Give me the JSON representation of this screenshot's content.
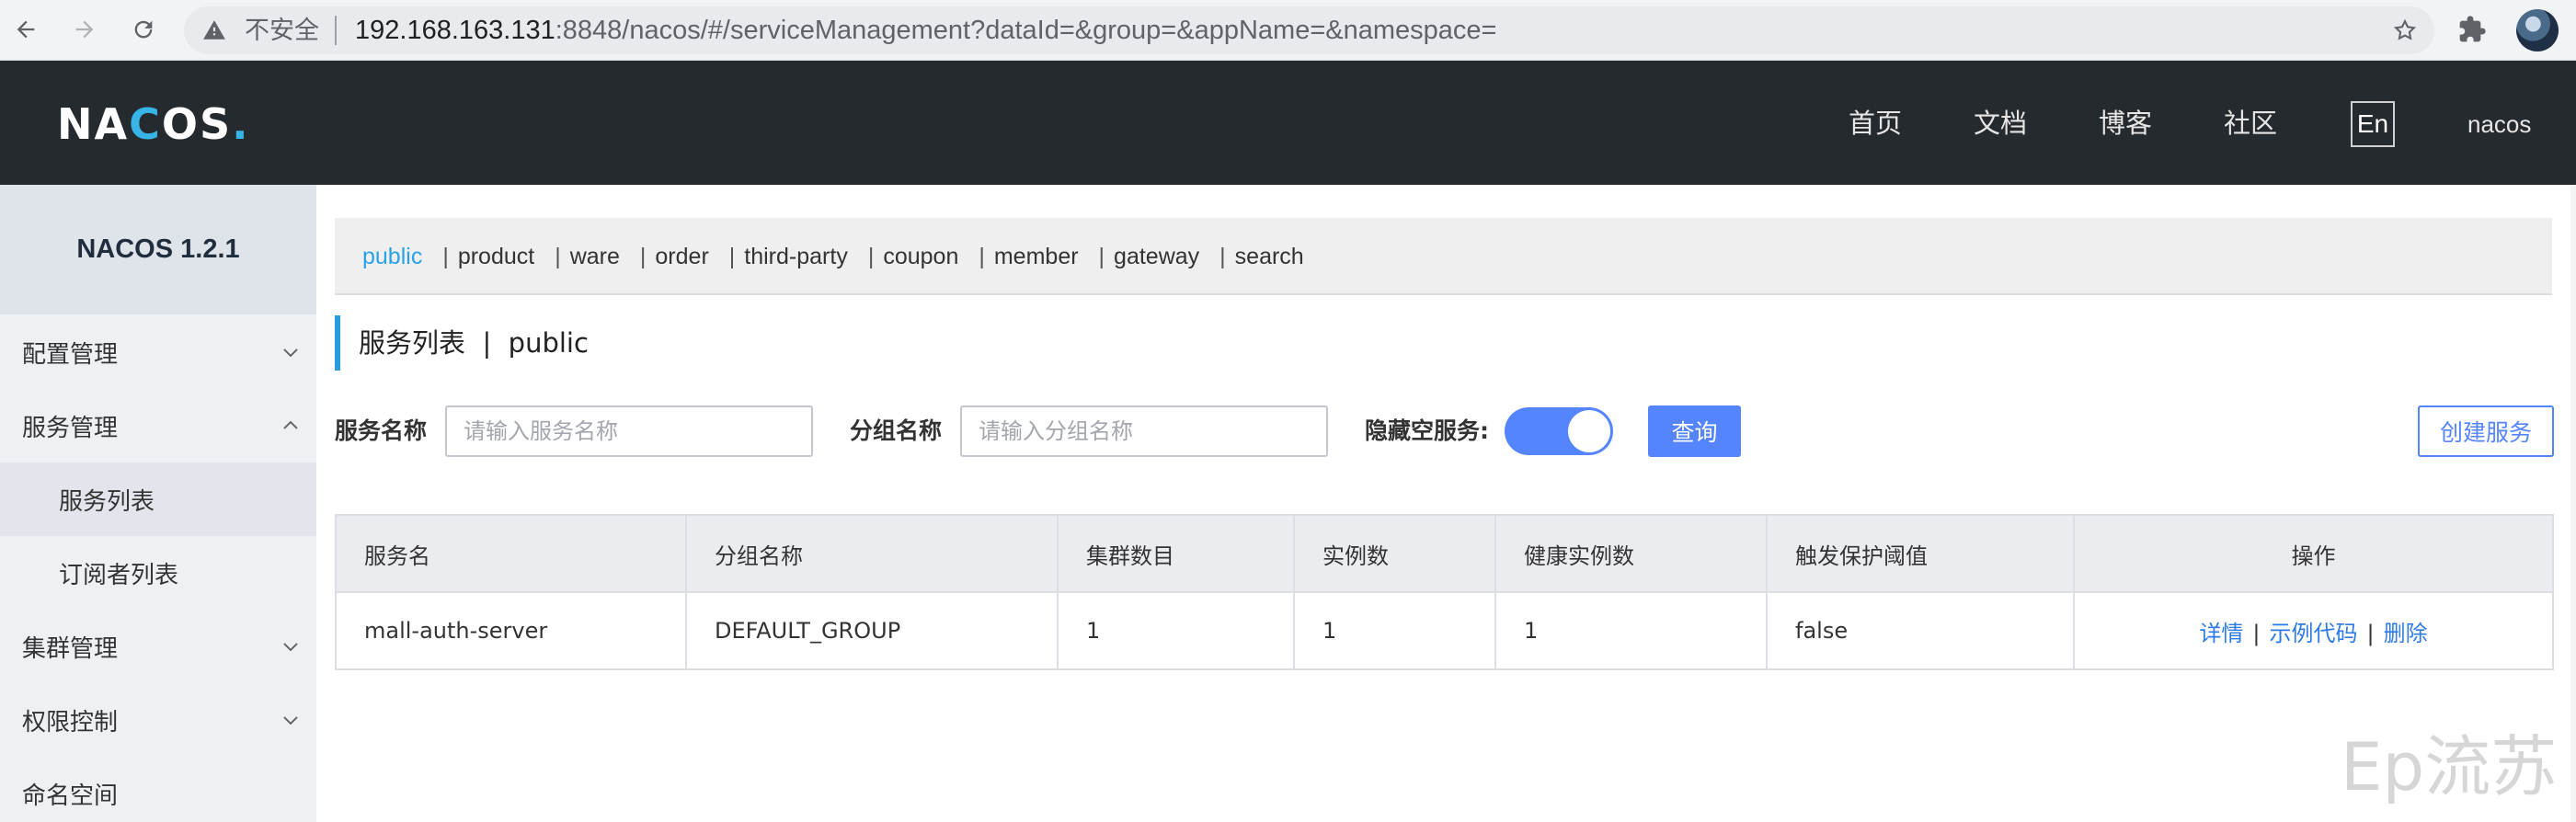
{
  "browser": {
    "insecure_label": "不安全",
    "url_host": "192.168.163.131",
    "url_rest": ":8848/nacos/#/serviceManagement?dataId=&group=&appName=&namespace="
  },
  "header": {
    "logo_n": "NA",
    "logo_o": "C",
    "logo_rest": "OS",
    "logo_dot": ".",
    "nav": [
      "首页",
      "文档",
      "博客",
      "社区"
    ],
    "lang": "En",
    "user": "nacos"
  },
  "sidebar": {
    "version": "NACOS 1.2.1",
    "items": [
      {
        "label": "配置管理"
      },
      {
        "label": "服务管理"
      },
      {
        "label": "服务列表"
      },
      {
        "label": "订阅者列表"
      },
      {
        "label": "集群管理"
      },
      {
        "label": "权限控制"
      },
      {
        "label": "命名空间"
      }
    ]
  },
  "namespaces": {
    "items": [
      "public",
      "product",
      "ware",
      "order",
      "third-party",
      "coupon",
      "member",
      "gateway",
      "search"
    ],
    "active": "public"
  },
  "page": {
    "title": "服务列表",
    "sep": "|",
    "namespace": "public"
  },
  "form": {
    "service_name_label": "服务名称",
    "service_name_placeholder": "请输入服务名称",
    "group_name_label": "分组名称",
    "group_name_placeholder": "请输入分组名称",
    "hide_empty_label": "隐藏空服务:",
    "hide_empty_on": true,
    "query_button": "查询",
    "create_button": "创建服务"
  },
  "table": {
    "headers": [
      "服务名",
      "分组名称",
      "集群数目",
      "实例数",
      "健康实例数",
      "触发保护阈值",
      "操作"
    ],
    "rows": [
      {
        "service": "mall-auth-server",
        "group": "DEFAULT_GROUP",
        "clusters": "1",
        "instances": "1",
        "healthy": "1",
        "threshold": "false",
        "ops": [
          "详情",
          "示例代码",
          "删除"
        ]
      }
    ],
    "op_sep": "|"
  },
  "watermark": "Ep流苏",
  "colors": {
    "header_bg": "#252a2f",
    "primary": "#5584ff",
    "active_ns": "#2aa1e6",
    "link": "#2c7be5"
  }
}
